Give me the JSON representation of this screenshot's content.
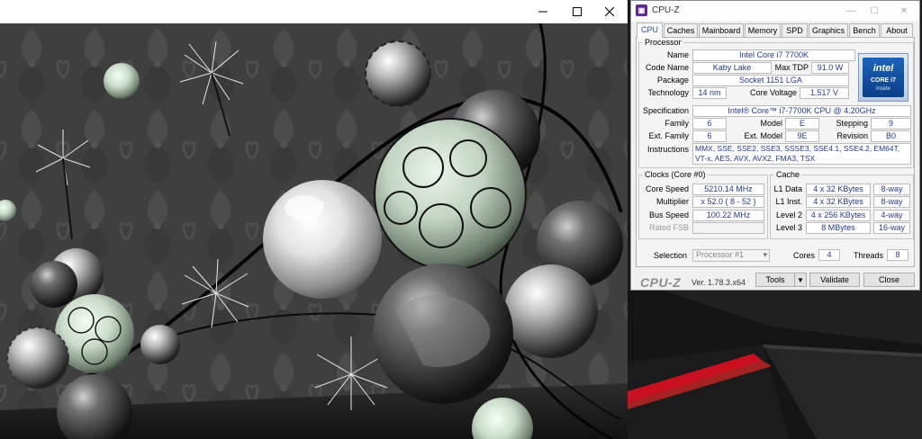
{
  "cpuz": {
    "window_title": "CPU-Z",
    "tabs": [
      {
        "label": "CPU"
      },
      {
        "label": "Caches"
      },
      {
        "label": "Mainboard"
      },
      {
        "label": "Memory"
      },
      {
        "label": "SPD"
      },
      {
        "label": "Graphics"
      },
      {
        "label": "Bench"
      },
      {
        "label": "About"
      }
    ],
    "processor": {
      "legend": "Processor",
      "name_label": "Name",
      "name": "Intel Core i7 7700K",
      "codename_label": "Code Name",
      "codename": "Kaby Lake",
      "maxtdp_label": "Max TDP",
      "maxtdp": "91.0 W",
      "package_label": "Package",
      "package": "Socket 1151 LGA",
      "technology_label": "Technology",
      "technology": "14 nm",
      "corevoltage_label": "Core Voltage",
      "corevoltage": "1.517 V",
      "spec_label": "Specification",
      "spec": "Intel® Core™ i7-7700K CPU @ 4.20GHz",
      "family_label": "Family",
      "family": "6",
      "model_label": "Model",
      "model": "E",
      "stepping_label": "Stepping",
      "stepping": "9",
      "extfamily_label": "Ext. Family",
      "extfamily": "6",
      "extmodel_label": "Ext. Model",
      "extmodel": "9E",
      "revision_label": "Revision",
      "revision": "B0",
      "instructions_label": "Instructions",
      "instructions": "MMX, SSE, SSE2, SSE3, SSSE3, SSE4.1, SSE4.2, EM64T, VT-x, AES, AVX, AVX2, FMA3, TSX"
    },
    "badge": {
      "brand": "intel",
      "line1": "CORE i7",
      "line2": "inside",
      "color": "#0a57a8"
    },
    "clocks": {
      "legend": "Clocks (Core #0)",
      "corespeed_label": "Core Speed",
      "corespeed": "5210.14 MHz",
      "multiplier_label": "Multiplier",
      "multiplier": "x 52.0 ( 8 - 52 )",
      "busspeed_label": "Bus Speed",
      "busspeed": "100.22 MHz",
      "ratedfsb_label": "Rated FSB",
      "ratedfsb": ""
    },
    "cache": {
      "legend": "Cache",
      "l1data_label": "L1 Data",
      "l1data": "4 x 32 KBytes",
      "l1data_way": "8-way",
      "l1inst_label": "L1 Inst.",
      "l1inst": "4 x 32 KBytes",
      "l1inst_way": "8-way",
      "level2_label": "Level 2",
      "level2": "4 x 256 KBytes",
      "level2_way": "4-way",
      "level3_label": "Level 3",
      "level3": "8 MBytes",
      "level3_way": "16-way"
    },
    "selection": {
      "label": "Selection",
      "value": "Processor #1",
      "cores_label": "Cores",
      "cores": "4",
      "threads_label": "Threads",
      "threads": "8"
    },
    "footer": {
      "logo": "CPU-Z",
      "version": "Ver. 1.78.3.x64",
      "tools_label": "Tools",
      "validate_label": "Validate",
      "close_label": "Close"
    }
  },
  "render_window": {
    "icons": [
      "minimize-icon",
      "maximize-icon",
      "close-icon"
    ]
  },
  "colors": {
    "accent_value_text": "#233a8c",
    "intel_blue": "#0a57a8",
    "desktop_red": "#c8101e"
  }
}
